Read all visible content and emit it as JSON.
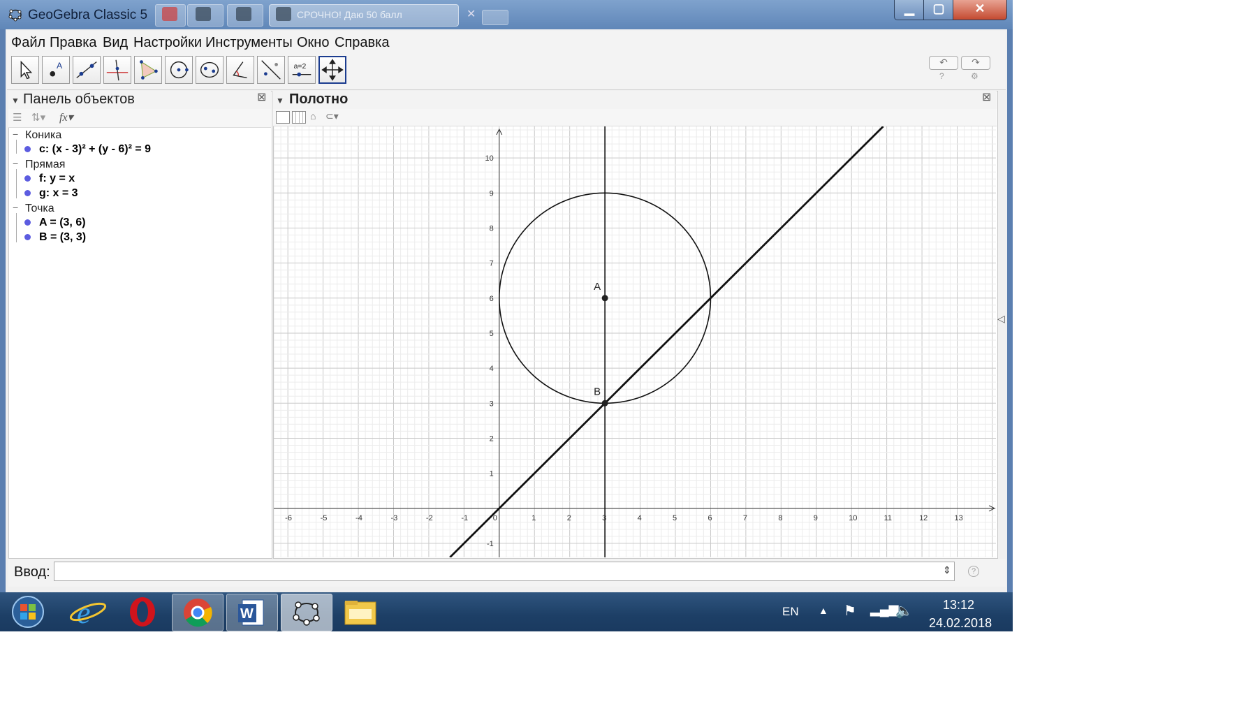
{
  "window": {
    "title": "GeoGebra Classic 5",
    "browser_tab": "СРОЧНО! Даю 50 балл"
  },
  "menu": [
    "Файл",
    "Правка",
    "Вид",
    "Настройки",
    "Инструменты",
    "Окно",
    "Справка"
  ],
  "tools": [
    "move-tool",
    "point-tool",
    "line-tool",
    "perpendicular-tool",
    "polygon-tool",
    "circle-tool",
    "ellipse-tool",
    "angle-tool",
    "reflect-tool",
    "slider-tool",
    "move-view-tool"
  ],
  "algebra": {
    "title": "Панель объектов",
    "groups": [
      {
        "label": "Коника",
        "items": [
          "c: (x - 3)² + (y - 6)² = 9"
        ]
      },
      {
        "label": "Прямая",
        "items": [
          "f: y = x",
          "g: x = 3"
        ]
      },
      {
        "label": "Точка",
        "items": [
          "A = (3, 6)",
          "B = (3, 3)"
        ]
      }
    ]
  },
  "graphics": {
    "title": "Полотно",
    "x_ticks": [
      "-6",
      "-5",
      "-4",
      "-3",
      "-2",
      "-1",
      "0",
      "1",
      "2",
      "3",
      "4",
      "5",
      "6",
      "7",
      "8",
      "9",
      "10",
      "11",
      "12",
      "13"
    ],
    "y_ticks": [
      "-1",
      "1",
      "2",
      "3",
      "4",
      "5",
      "6",
      "7",
      "8",
      "9",
      "10"
    ],
    "xlim": [
      -6.4,
      14.1
    ],
    "ylim": [
      -1.4,
      10.9
    ],
    "circle": {
      "cx": 3,
      "cy": 6,
      "r": 3
    },
    "points": [
      {
        "label": "A",
        "x": 3,
        "y": 6
      },
      {
        "label": "B",
        "x": 3,
        "y": 3
      }
    ],
    "line_f_slope": 1,
    "line_g_x": 3
  },
  "input": {
    "label": "Ввод:",
    "value": ""
  },
  "taskbar": {
    "lang": "EN",
    "time": "13:12",
    "date": "24.02.2018"
  },
  "colors": {
    "point_dot": "#5c5ce0",
    "titlebar": "#6f94c4"
  }
}
